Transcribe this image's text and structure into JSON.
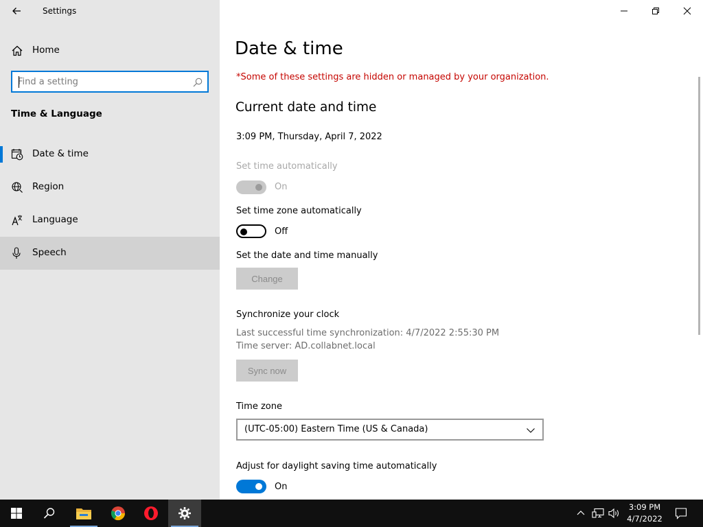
{
  "window": {
    "title": "Settings",
    "minimize_icon": "minimize-icon",
    "restore_icon": "restore-icon",
    "close_icon": "close-icon"
  },
  "sidebar": {
    "home_label": "Home",
    "search_placeholder": "Find a setting",
    "section_title": "Time & Language",
    "items": [
      {
        "label": "Date & time",
        "icon": "date-time-icon",
        "active": true
      },
      {
        "label": "Region",
        "icon": "region-globe-icon"
      },
      {
        "label": "Language",
        "icon": "language-icon"
      },
      {
        "label": "Speech",
        "icon": "microphone-icon",
        "hover": true
      }
    ]
  },
  "main": {
    "page_title": "Date & time",
    "org_note": "*Some of these settings are hidden or managed by your organization.",
    "current_section": "Current date and time",
    "current_datetime": "3:09 PM, Thursday, April 7, 2022",
    "set_time_auto": {
      "label": "Set time automatically",
      "state": "On",
      "disabled": true
    },
    "set_tz_auto": {
      "label": "Set time zone automatically",
      "state": "Off"
    },
    "manual": {
      "label": "Set the date and time manually",
      "button": "Change"
    },
    "sync": {
      "label": "Synchronize your clock",
      "last_sync": "Last successful time synchronization: 4/7/2022 2:55:30 PM",
      "server": "Time server: AD.collabnet.local",
      "button": "Sync now"
    },
    "timezone": {
      "label": "Time zone",
      "value": "(UTC-05:00) Eastern Time (US & Canada)"
    },
    "dst": {
      "label": "Adjust for daylight saving time automatically",
      "state": "On"
    }
  },
  "taskbar": {
    "time": "3:09 PM",
    "date": "4/7/2022",
    "apps": [
      "windows-start-icon",
      "search-icon",
      "file-explorer-icon",
      "chrome-icon",
      "opera-icon",
      "settings-gear-icon"
    ]
  },
  "colors": {
    "accent": "#0078d7",
    "warning": "#c50500",
    "sidebar_bg": "#e6e6e6",
    "taskbar_bg": "#101010"
  }
}
